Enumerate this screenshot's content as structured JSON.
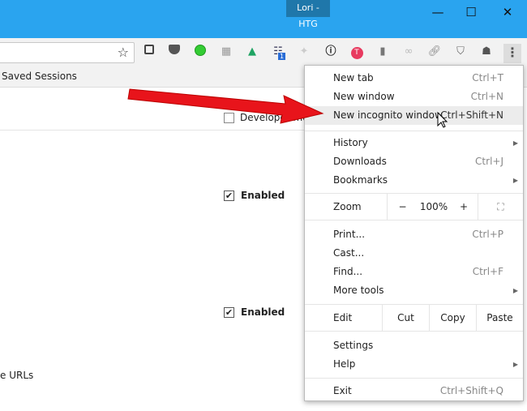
{
  "window": {
    "profile": "Lori - HTG",
    "minimize": "—",
    "maximize": "☐",
    "close": "✕"
  },
  "toolbar": {
    "star": "☆",
    "extensions": [
      "square-icon",
      "pocket-icon",
      "green-dot-icon",
      "grid-icon",
      "drive-icon",
      "tree-icon",
      "pin-icon",
      "onepassword-icon",
      "todoist-icon",
      "evernote-icon",
      "chain-grey-icon",
      "link-icon",
      "ublock-icon",
      "ghostery-icon"
    ],
    "badge": "1",
    "menu": "⋮"
  },
  "bookmarks": {
    "item": "Saved Sessions"
  },
  "page": {
    "developer_mode": "Developer mode",
    "enabled1": "Enabled",
    "enabled2": "Enabled",
    "urls": "e URLs"
  },
  "menu": {
    "new_tab": {
      "label": "New tab",
      "shortcut": "Ctrl+T"
    },
    "new_window": {
      "label": "New window",
      "shortcut": "Ctrl+N"
    },
    "incognito": {
      "label": "New incognito window",
      "shortcut": "Ctrl+Shift+N"
    },
    "history": "History",
    "downloads": {
      "label": "Downloads",
      "shortcut": "Ctrl+J"
    },
    "bookmarks": "Bookmarks",
    "zoom": {
      "label": "Zoom",
      "minus": "−",
      "value": "100%",
      "plus": "+"
    },
    "print": {
      "label": "Print...",
      "shortcut": "Ctrl+P"
    },
    "cast": "Cast...",
    "find": {
      "label": "Find...",
      "shortcut": "Ctrl+F"
    },
    "more_tools": "More tools",
    "edit": {
      "label": "Edit",
      "cut": "Cut",
      "copy": "Copy",
      "paste": "Paste"
    },
    "settings": "Settings",
    "help": "Help",
    "exit": {
      "label": "Exit",
      "shortcut": "Ctrl+Shift+Q"
    }
  },
  "colors": {
    "titlebar": "#2aa4ef",
    "arrow": "#e8141b"
  }
}
